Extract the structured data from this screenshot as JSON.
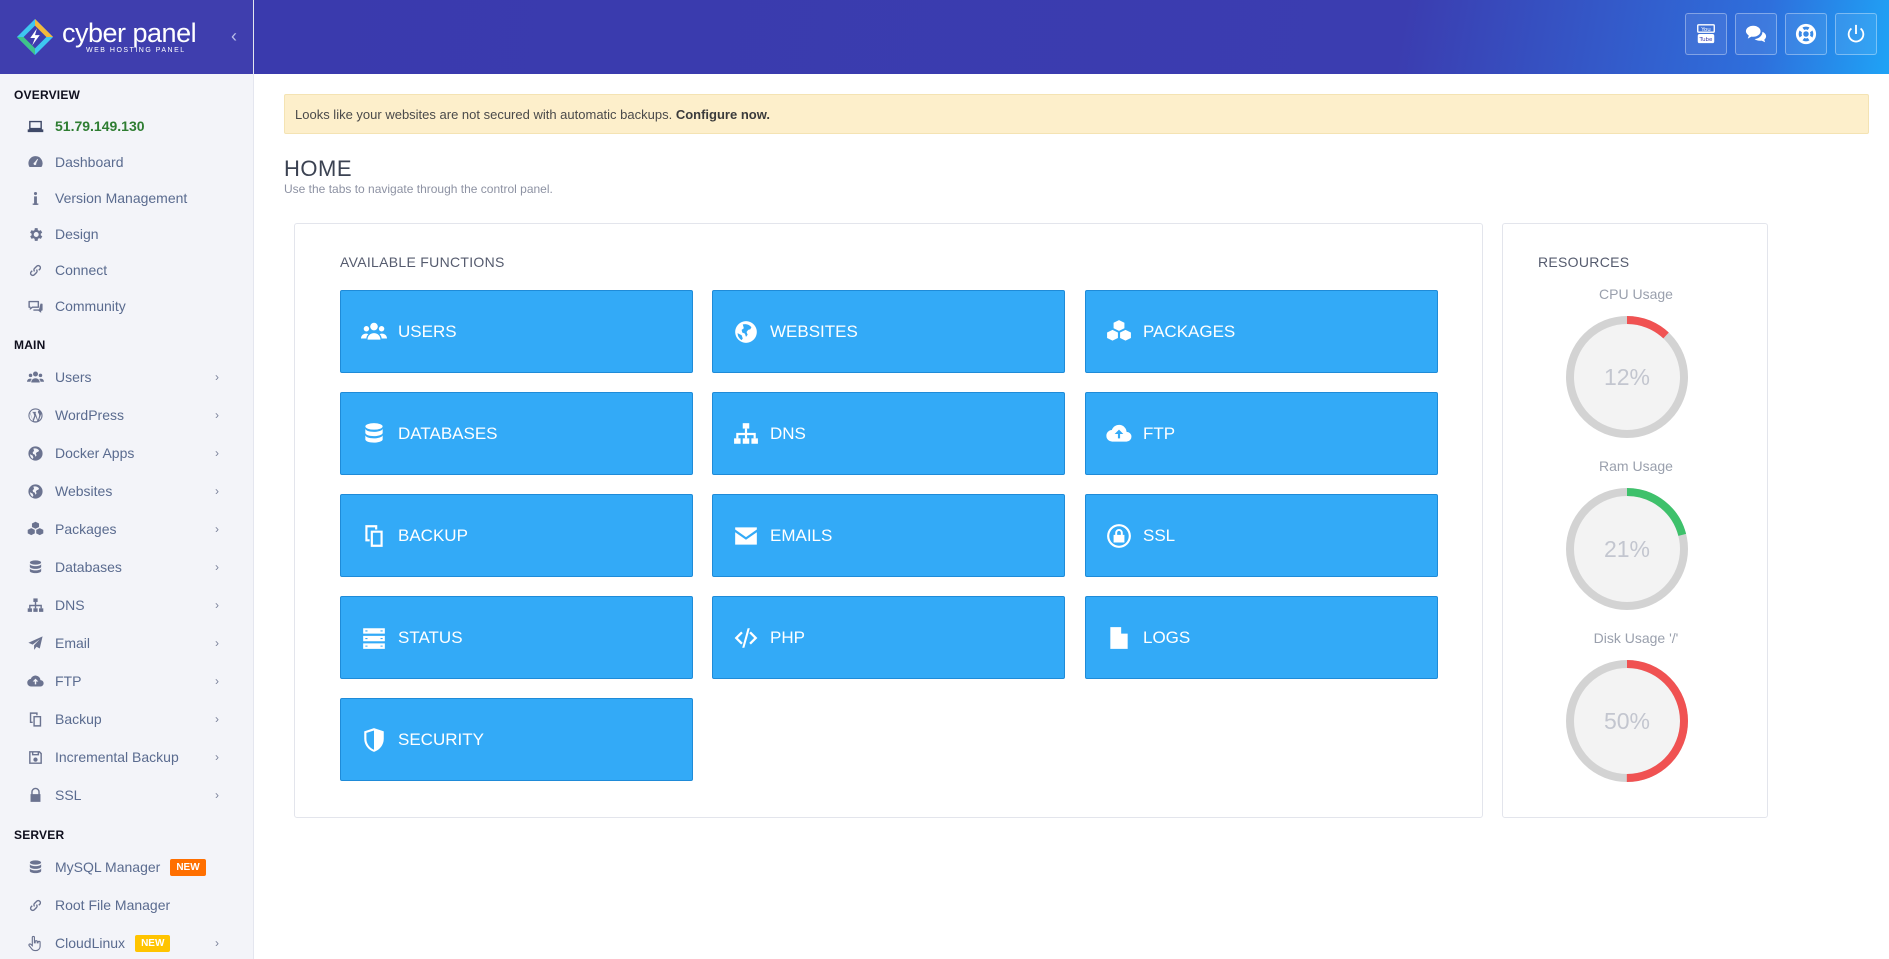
{
  "brand": {
    "name": "cyber panel",
    "tagline": "WEB HOSTING PANEL"
  },
  "sidebar": {
    "sections": {
      "overview": "OVERVIEW",
      "main": "MAIN",
      "server": "SERVER"
    },
    "overview_items": {
      "ip": "51.79.149.130",
      "dashboard": "Dashboard",
      "version": "Version Management",
      "design": "Design",
      "connect": "Connect",
      "community": "Community"
    },
    "main_items": {
      "users": "Users",
      "wordpress": "WordPress",
      "docker": "Docker Apps",
      "websites": "Websites",
      "packages": "Packages",
      "databases": "Databases",
      "dns": "DNS",
      "email": "Email",
      "ftp": "FTP",
      "backup": "Backup",
      "incremental": "Incremental Backup",
      "ssl": "SSL"
    },
    "server_items": {
      "mysql": "MySQL Manager",
      "mysql_badge": "NEW",
      "rootfm": "Root File Manager",
      "cloudlinux": "CloudLinux",
      "cloudlinux_badge": "NEW"
    }
  },
  "alert": {
    "text": "Looks like your websites are not secured with automatic backups.",
    "link": "Configure now."
  },
  "page": {
    "title": "HOME",
    "subtitle": "Use the tabs to navigate through the control panel."
  },
  "functions": {
    "title": "AVAILABLE FUNCTIONS",
    "tiles": {
      "users": "USERS",
      "websites": "WEBSITES",
      "packages": "PACKAGES",
      "databases": "DATABASES",
      "dns": "DNS",
      "ftp": "FTP",
      "backup": "BACKUP",
      "emails": "EMAILS",
      "ssl": "SSL",
      "status": "STATUS",
      "php": "PHP",
      "logs": "LOGS",
      "security": "SECURITY"
    }
  },
  "resources": {
    "title": "RESOURCES",
    "cpu": {
      "label": "CPU Usage",
      "value": "12%",
      "percent": 12,
      "color": "#f05252"
    },
    "ram": {
      "label": "Ram Usage",
      "value": "21%",
      "percent": 21,
      "color": "#3ec16b"
    },
    "disk": {
      "label": "Disk Usage '/'",
      "value": "50%",
      "percent": 50,
      "color": "#f05252"
    }
  },
  "icons": {
    "header": [
      "youtube-icon",
      "chat-icon",
      "lifebuoy-icon",
      "power-icon"
    ]
  }
}
